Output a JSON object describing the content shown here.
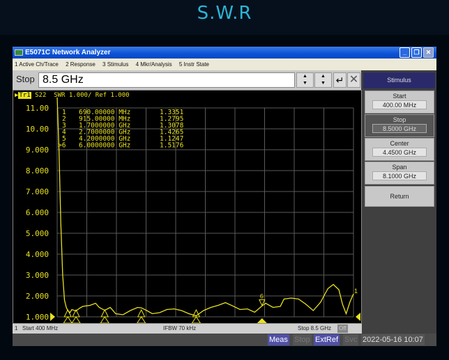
{
  "page": {
    "title": "S.W.R"
  },
  "window": {
    "title": "E5071C Network Analyzer",
    "minimize": "_",
    "restore": "❐",
    "close": "✕"
  },
  "menu": [
    "1 Active Ch/Trace",
    "2 Response",
    "3 Stimulus",
    "4 Mkr/Analysis",
    "5 Instr State"
  ],
  "entry": {
    "label": "Stop",
    "value": "8.5 GHz",
    "enter_icon": "↵",
    "cancel_icon": "✕"
  },
  "trace_header": {
    "trace": "Tr1",
    "text": " S22  SWR 1.000/ Ref 1.000"
  },
  "softkeys": {
    "title": "Stimulus",
    "items": [
      {
        "label": "Start",
        "value": "400.00 MHz",
        "active": false
      },
      {
        "label": "Stop",
        "value": "8.5000 GHz",
        "active": true
      },
      {
        "label": "Center",
        "value": "4.4500 GHz",
        "active": false
      },
      {
        "label": "Span",
        "value": "8.1000 GHz",
        "active": false
      }
    ],
    "return": "Return"
  },
  "channel_bar": {
    "channel": "1",
    "start": "Start 400 MHz",
    "ifbw": "IFBW 70 kHz",
    "stop": "Stop 8.5 GHz",
    "off": "Off"
  },
  "status_bar": {
    "meas": "Meas",
    "stop": "Stop",
    "extref": "ExtRef",
    "svc": "Svc",
    "datetime": "2022-05-16 10:07"
  },
  "colors": {
    "trace": "#e8e020",
    "grid": "#5a5a5a",
    "accent": "#2bb5d8"
  },
  "chart_data": {
    "type": "line",
    "xlim_ghz": [
      0.4,
      8.5
    ],
    "ylim": [
      1,
      11
    ],
    "yticks": [
      "11.00",
      "10.00",
      "9.000",
      "8.000",
      "7.000",
      "6.000",
      "5.000",
      "4.000",
      "3.000",
      "2.000",
      "1.000"
    ],
    "grid": true,
    "series": [
      {
        "x": [
          0.4,
          0.45,
          0.5,
          0.55,
          0.6,
          0.65,
          0.69,
          0.75,
          0.8,
          0.915,
          1.0,
          1.1,
          1.3,
          1.45,
          1.55,
          1.7,
          1.85,
          2.0,
          2.2,
          2.4,
          2.6,
          2.7,
          2.85,
          3.0,
          3.2,
          3.4,
          3.6,
          3.8,
          4.0,
          4.2,
          4.4,
          4.6,
          4.8,
          5.0,
          5.2,
          5.4,
          5.6,
          5.8,
          6.0,
          6.1,
          6.3,
          6.5,
          6.6,
          6.8,
          7.0,
          7.2,
          7.4,
          7.6,
          7.8,
          7.95,
          8.1,
          8.2,
          8.3,
          8.4,
          8.5
        ],
        "y": [
          11.5,
          9.0,
          5.5,
          3.0,
          1.8,
          1.45,
          1.3,
          1.2,
          1.35,
          1.28,
          1.4,
          1.5,
          1.55,
          1.65,
          1.45,
          1.31,
          1.45,
          1.15,
          1.1,
          1.3,
          1.45,
          1.43,
          1.3,
          1.15,
          1.2,
          1.35,
          1.38,
          1.3,
          1.15,
          1.05,
          1.3,
          1.45,
          1.55,
          1.68,
          1.52,
          1.35,
          1.38,
          1.22,
          1.52,
          1.65,
          1.45,
          1.5,
          1.85,
          1.9,
          1.85,
          1.6,
          1.3,
          1.7,
          2.35,
          2.55,
          2.3,
          1.6,
          1.15,
          1.7,
          2.1
        ]
      }
    ],
    "markers": [
      {
        "n": "1",
        "freq": "690.00000 MHz",
        "f": 0.69,
        "value": "1.3351"
      },
      {
        "n": "2",
        "freq": "915.00000 MHz",
        "f": 0.915,
        "value": "1.2795"
      },
      {
        "n": "3",
        "freq": "1.7000000 GHz",
        "f": 1.7,
        "value": "1.3078"
      },
      {
        "n": "4",
        "freq": "2.7000000 GHz",
        "f": 2.7,
        "value": "1.4265"
      },
      {
        "n": "5",
        "freq": "4.2000000 GHz",
        "f": 4.2,
        "value": "1.1247"
      },
      {
        "n": ">6",
        "freq": "6.0000000 GHz",
        "f": 6.0,
        "value": "1.5176"
      }
    ]
  }
}
